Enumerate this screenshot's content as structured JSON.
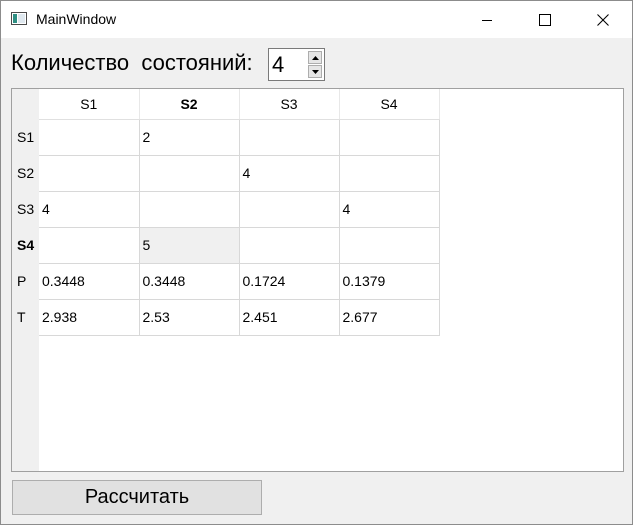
{
  "window": {
    "title": "MainWindow"
  },
  "controls": {
    "count_label": "Количество  состояний:",
    "count_value": "4"
  },
  "table": {
    "columns": [
      {
        "label": "S1",
        "bold": false
      },
      {
        "label": "S2",
        "bold": true
      },
      {
        "label": "S3",
        "bold": false
      },
      {
        "label": "S4",
        "bold": false
      }
    ],
    "rows": [
      {
        "label": "S1",
        "bold": false,
        "cells": [
          "",
          "2",
          "",
          ""
        ]
      },
      {
        "label": "S2",
        "bold": false,
        "cells": [
          "",
          "",
          "4",
          ""
        ]
      },
      {
        "label": "S3",
        "bold": false,
        "cells": [
          "4",
          "",
          "",
          "4"
        ]
      },
      {
        "label": "S4",
        "bold": true,
        "cells": [
          "",
          "5",
          "",
          ""
        ]
      },
      {
        "label": "P",
        "bold": false,
        "cells": [
          "0.3448",
          "0.3448",
          "0.1724",
          "0.1379"
        ]
      },
      {
        "label": "T",
        "bold": false,
        "cells": [
          "2.938",
          "2.53",
          "2.451",
          "2.677"
        ]
      }
    ],
    "selected_cell": {
      "row": 3,
      "col": 1
    }
  },
  "buttons": {
    "calculate": "Рассчитать"
  }
}
